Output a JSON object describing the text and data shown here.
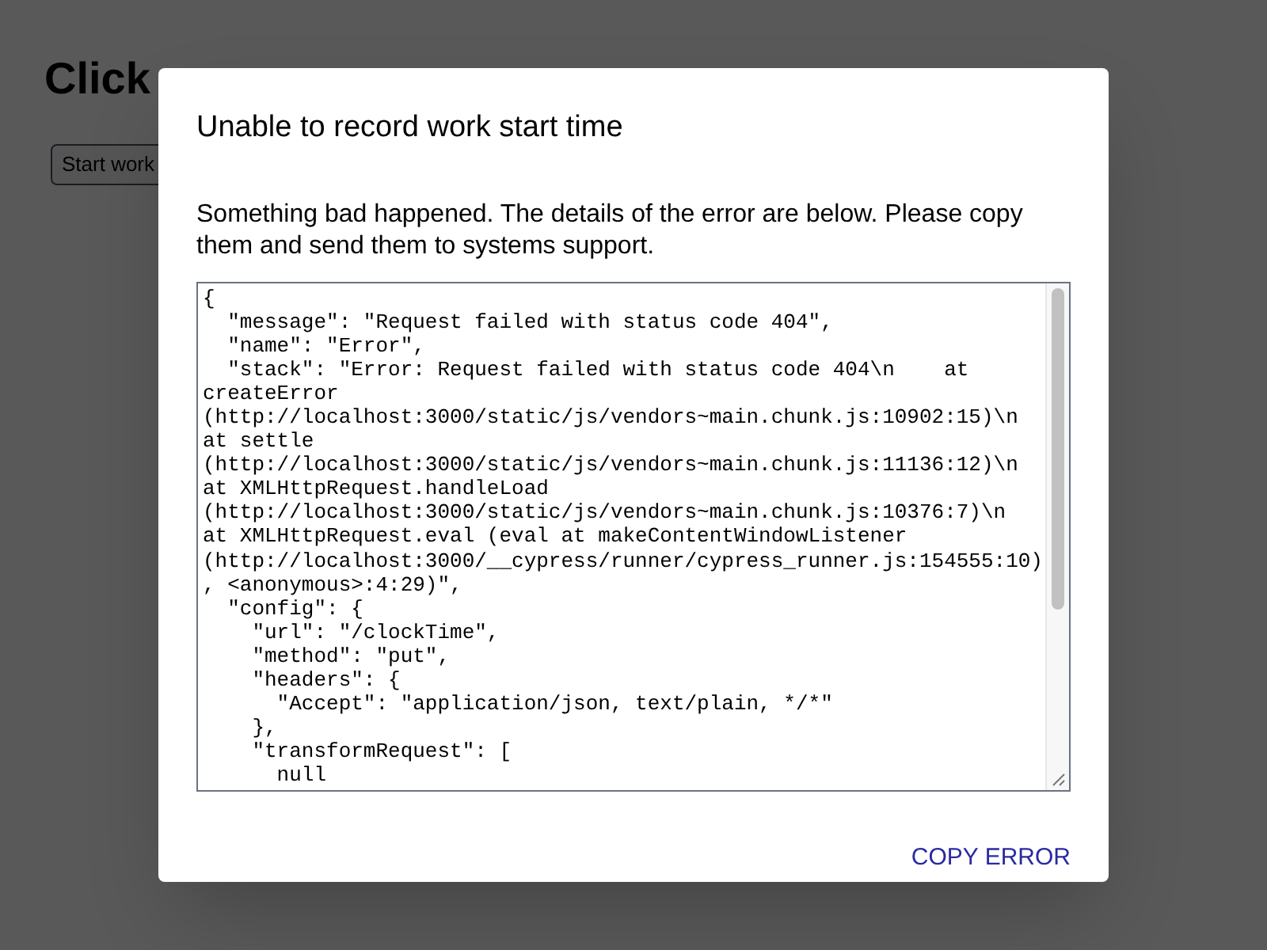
{
  "page": {
    "heading": "Click",
    "start_button": "Start work"
  },
  "dialog": {
    "title": "Unable to record work start time",
    "message": "Something bad happened. The details of the error are below. Please copy them and send them to systems support.",
    "error_lines": [
      "{",
      "  \"message\": \"Request failed with status code 404\",",
      "  \"name\": \"Error\",",
      "  \"stack\": \"Error: Request failed with status code 404\\n    at",
      "createError",
      "(http://localhost:3000/static/js/vendors~main.chunk.js:10902:15)\\n",
      "at settle",
      "(http://localhost:3000/static/js/vendors~main.chunk.js:11136:12)\\n",
      "at XMLHttpRequest.handleLoad",
      "(http://localhost:3000/static/js/vendors~main.chunk.js:10376:7)\\n",
      "at XMLHttpRequest.eval (eval at makeContentWindowListener",
      "(http://localhost:3000/__cypress/runner/cypress_runner.js:154555:10)",
      ", <anonymous>:4:29)\",",
      "  \"config\": {",
      "    \"url\": \"/clockTime\",",
      "    \"method\": \"put\",",
      "    \"headers\": {",
      "      \"Accept\": \"application/json, text/plain, */*\"",
      "    },",
      "    \"transformRequest\": [",
      "      null"
    ],
    "copy_button": "COPY ERROR"
  }
}
